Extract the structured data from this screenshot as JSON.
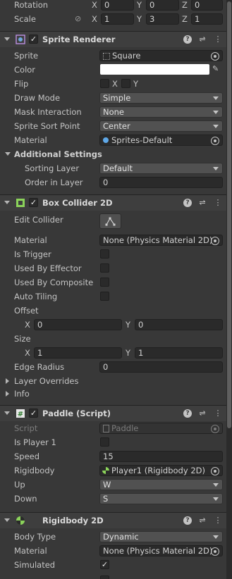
{
  "transform": {
    "rotation": {
      "label": "Rotation",
      "x": "0",
      "y": "0",
      "z": "0"
    },
    "scale": {
      "label": "Scale",
      "x": "1",
      "y": "3",
      "z": "1"
    }
  },
  "axes": {
    "x": "X",
    "y": "Y",
    "z": "Z"
  },
  "sprite_renderer": {
    "title": "Sprite Renderer",
    "sprite": {
      "label": "Sprite",
      "value": "Square"
    },
    "color": {
      "label": "Color",
      "value": "#ffffff"
    },
    "flip": {
      "label": "Flip",
      "x": "X",
      "y": "Y"
    },
    "draw_mode": {
      "label": "Draw Mode",
      "value": "Simple"
    },
    "mask_interaction": {
      "label": "Mask Interaction",
      "value": "None"
    },
    "sort_point": {
      "label": "Sprite Sort Point",
      "value": "Center"
    },
    "material": {
      "label": "Material",
      "value": "Sprites-Default"
    },
    "additional": {
      "label": "Additional Settings"
    },
    "sorting_layer": {
      "label": "Sorting Layer",
      "value": "Default"
    },
    "order_in_layer": {
      "label": "Order in Layer",
      "value": "0"
    }
  },
  "box_collider": {
    "title": "Box Collider 2D",
    "edit_collider": {
      "label": "Edit Collider"
    },
    "material": {
      "label": "Material",
      "value": "None (Physics Material 2D)"
    },
    "is_trigger": {
      "label": "Is Trigger"
    },
    "used_by_effector": {
      "label": "Used By Effector"
    },
    "used_by_composite": {
      "label": "Used By Composite"
    },
    "auto_tiling": {
      "label": "Auto Tiling"
    },
    "offset": {
      "label": "Offset",
      "x": "0",
      "y": "0"
    },
    "size": {
      "label": "Size",
      "x": "1",
      "y": "1"
    },
    "edge_radius": {
      "label": "Edge Radius",
      "value": "0"
    },
    "layer_overrides": {
      "label": "Layer Overrides"
    },
    "info": {
      "label": "Info"
    }
  },
  "paddle": {
    "title": "Paddle (Script)",
    "script": {
      "label": "Script",
      "value": "Paddle"
    },
    "is_player1": {
      "label": "Is Player 1"
    },
    "speed": {
      "label": "Speed",
      "value": "15"
    },
    "rigidbody": {
      "label": "Rigidbody",
      "value": "Player1 (Rigidbody 2D)"
    },
    "up": {
      "label": "Up",
      "value": "W"
    },
    "down": {
      "label": "Down",
      "value": "S"
    }
  },
  "rigidbody2d": {
    "title": "Rigidbody 2D",
    "body_type": {
      "label": "Body Type",
      "value": "Dynamic"
    },
    "material": {
      "label": "Material",
      "value": "None (Physics Material 2D)"
    },
    "simulated": {
      "label": "Simulated"
    }
  },
  "icons": {
    "check": "✓",
    "preset": "⇌",
    "more": "⋮",
    "help": "?"
  },
  "colors": {
    "background": "#383838",
    "header": "#3e3e3e",
    "field": "#2a2a2a",
    "dropdown": "#515151",
    "collider_green": "#8bd35a"
  }
}
